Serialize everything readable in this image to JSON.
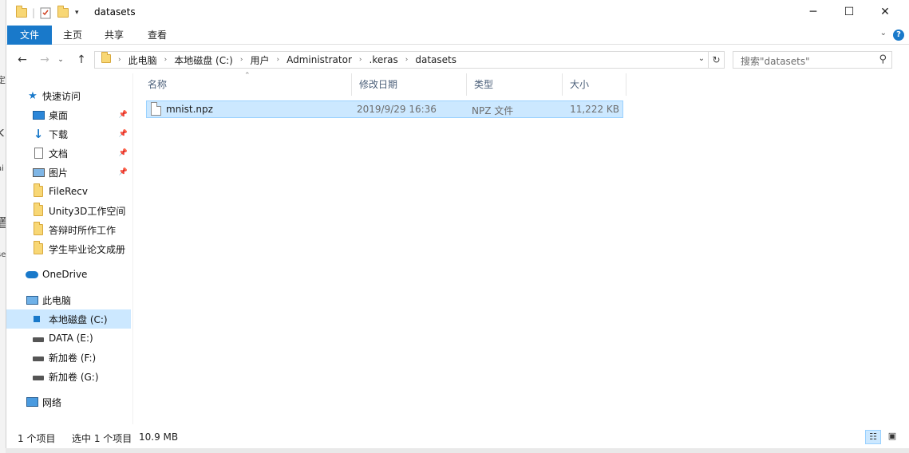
{
  "window": {
    "title": "datasets",
    "controls": {
      "minimize": "─",
      "maximize": "☐",
      "close": "✕"
    }
  },
  "ribbon": {
    "tabs": [
      "文件",
      "主页",
      "共享",
      "查看"
    ],
    "help": "?"
  },
  "address": {
    "crumbs": [
      "此电脑",
      "本地磁盘 (C:)",
      "用户",
      "Administrator",
      ".keras",
      "datasets"
    ],
    "search_placeholder": "搜索\"datasets\""
  },
  "nav": {
    "quick_access": "快速访问",
    "items_pinned": [
      {
        "label": "桌面",
        "icon": "desktop-icon"
      },
      {
        "label": "下载",
        "icon": "download-icon"
      },
      {
        "label": "文档",
        "icon": "document-icon"
      },
      {
        "label": "图片",
        "icon": "pictures-icon"
      }
    ],
    "items_folders": [
      "FileRecv",
      "Unity3D工作空间",
      "答辩时所作工作",
      "学生毕业论文成册"
    ],
    "onedrive": "OneDrive",
    "this_pc": "此电脑",
    "drives": [
      {
        "label": "本地磁盘 (C:)",
        "selected": true
      },
      {
        "label": "DATA (E:)",
        "selected": false
      },
      {
        "label": "新加卷 (F:)",
        "selected": false
      },
      {
        "label": "新加卷 (G:)",
        "selected": false
      }
    ],
    "network": "网络"
  },
  "columns": [
    "名称",
    "修改日期",
    "类型",
    "大小"
  ],
  "files": [
    {
      "name": "mnist.npz",
      "modified": "2019/9/29 16:36",
      "type": "NPZ 文件",
      "size": "11,222 KB"
    }
  ],
  "status": {
    "count": "1 个项目",
    "selected": "选中 1 个项目",
    "size": "10.9 MB"
  }
}
